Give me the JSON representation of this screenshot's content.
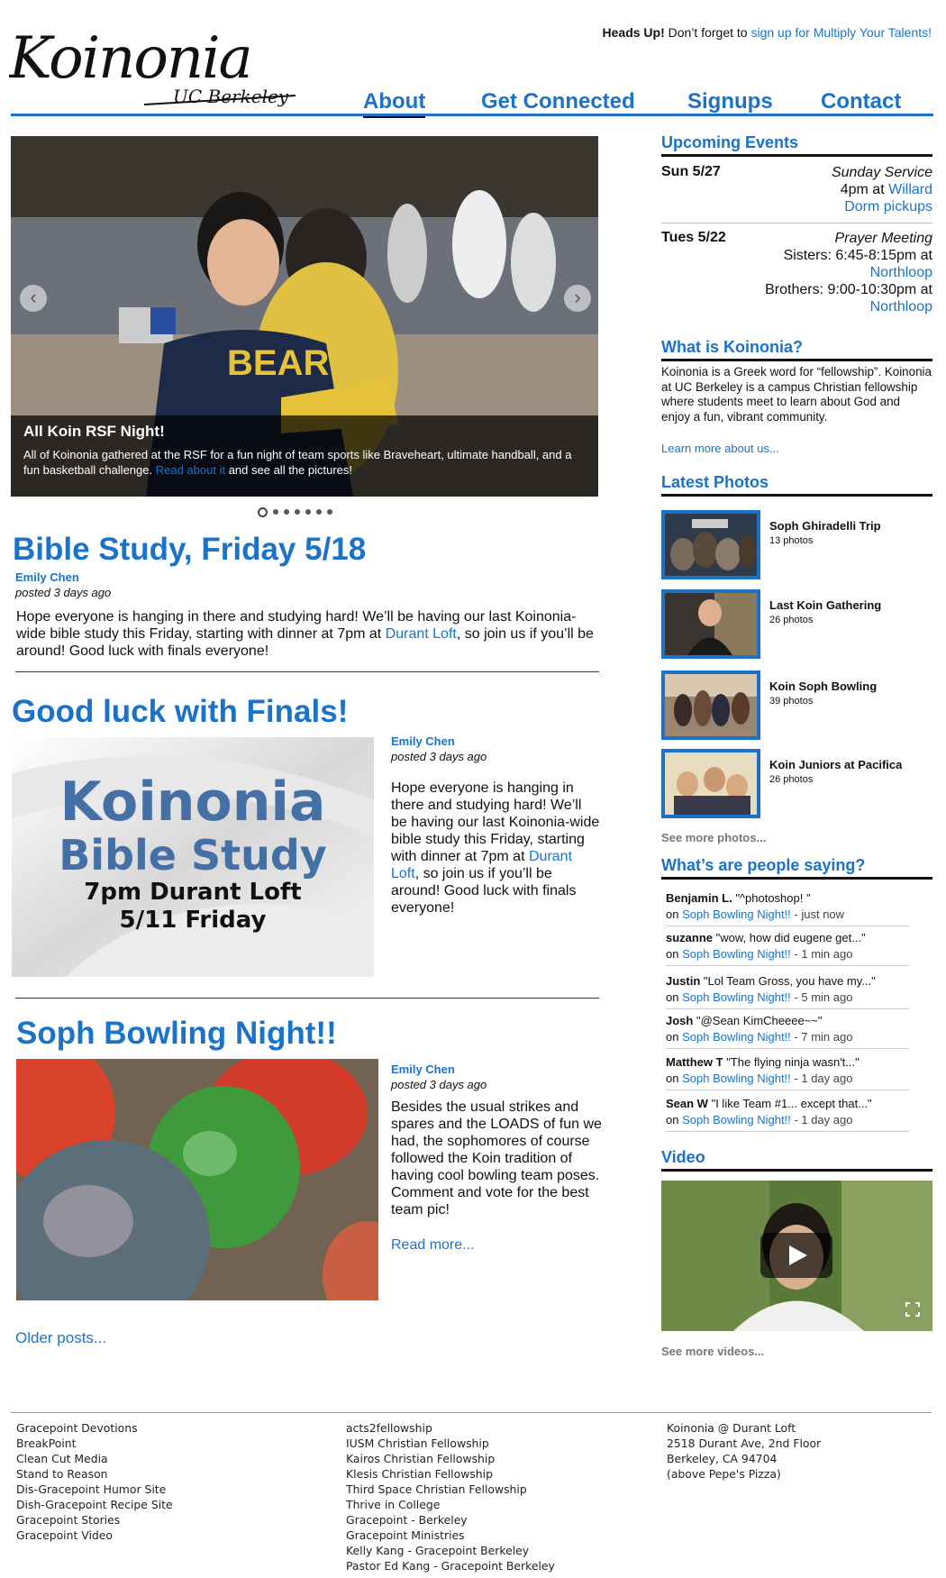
{
  "brand": {
    "name": "Koinonia",
    "sub": "UC Berkeley"
  },
  "heads_up": {
    "bold": "Heads Up!",
    "text": "Don’t forget to",
    "link": "sign up for Multiply Your Talents!"
  },
  "nav": [
    "About",
    "Get Connected",
    "Signups",
    "Contact"
  ],
  "slider": {
    "title": "All Koin RSF Night!",
    "text_before": "All of Koinonia gathered at the RSF for a fun night of team sports like Braveheart, ultimate handball, and a fun basketball challenge.",
    "link": "Read about it",
    "text_after": "and see all the pictures!",
    "shirt_text": "BEAR",
    "slides": 7,
    "active_slide": 1
  },
  "posts": [
    {
      "title": "Bible Study, Friday 5/18",
      "author": "Emily Chen",
      "posted": "posted 3 days ago",
      "body_before": "Hope everyone is hanging in there and studying hard! We’ll be having our last Koinonia-wide bible study this Friday, starting with dinner at 7pm at",
      "body_link": "Durant Loft",
      "body_after": ", so join us if you’ll be around! Good luck with finals everyone!"
    },
    {
      "title": "Good luck with Finals!",
      "author": "Emily Chen",
      "posted": "posted 3 days ago",
      "poster": {
        "line1": "Koinonia",
        "line2": "Bible Study",
        "line3": "7pm Durant Loft",
        "line4": "5/11 Friday"
      },
      "body_before": "Hope everyone is hanging in there and studying hard! We’ll be having our last Koinonia-wide bible study this Friday, starting with dinner at 7pm at",
      "body_link": "Durant Loft",
      "body_after": ", so join us if you’ll be around! Good luck with finals everyone!"
    },
    {
      "title": "Soph Bowling Night!!",
      "author": "Emily Chen",
      "posted": "posted 3 days ago",
      "body": "Besides the usual strikes and spares and the LOADS of fun we had, the sophomores of course followed the Koin tradition of having cool bowling team poses. Comment and vote for the best team pic!",
      "read_more": "Read more..."
    }
  ],
  "older_posts": "Older posts...",
  "sidebar": {
    "events_heading": "Upcoming Events",
    "events": [
      {
        "date": "Sun 5/27",
        "name": "Sunday Service",
        "time": "4pm at",
        "place": "Willard",
        "extra": "Dorm pickups"
      },
      {
        "date": "Tues 5/22",
        "name": "Prayer Meeting",
        "sisters": "Sisters: 6:45-8:15pm at",
        "sisters_place": "Northloop",
        "brothers": "Brothers: 9:00-10:30pm at",
        "brothers_place": "Northloop"
      }
    ],
    "what_heading": "What is Koinonia?",
    "what_text": "Koinonia is a Greek word for “fellowship”. Koinonia at UC Berkeley is a campus Christian fellowship where students meet to learn about God and enjoy a fun, vibrant community.",
    "learn_more": "Learn more about us...",
    "photos_heading": "Latest Photos",
    "photos": [
      {
        "title": "Soph Ghiradelli Trip",
        "count": "13 photos"
      },
      {
        "title": "Last Koin Gathering",
        "count": "26 photos"
      },
      {
        "title": "Koin Soph Bowling",
        "count": "39 photos"
      },
      {
        "title": "Koin Juniors at Pacifica",
        "count": "26 photos"
      }
    ],
    "see_more_photos": "See more photos...",
    "comments_heading": "What’s are people saying?",
    "comments": [
      {
        "user": "Benjamin L.",
        "quote": "\"^photoshop!  \"",
        "on": "on",
        "post": "Soph Bowling Night!!",
        "time": "- just now"
      },
      {
        "user": "suzanne",
        "quote": "\"wow, how did eugene get...\"",
        "on": "on",
        "post": "Soph Bowling Night!!",
        "time": "- 1 min ago"
      },
      {
        "user": "Justin",
        "quote": "\"Lol Team Gross, you have my...\"",
        "on": "on",
        "post": "Soph Bowling Night!!",
        "time": "- 5 min ago"
      },
      {
        "user": "Josh",
        "quote": "\"@Sean KimCheeee~~\"",
        "on": "on",
        "post": "Soph Bowling Night!!",
        "time": "- 7 min ago"
      },
      {
        "user": "Matthew T",
        "quote": "\"The flying ninja wasn't...\"",
        "on": "on",
        "post": "Soph Bowling Night!!",
        "time": "- 1 day ago"
      },
      {
        "user": "Sean W",
        "quote": "\"I like Team #1... except that...\"",
        "on": "on",
        "post": "Soph Bowling Night!!",
        "time": "- 1 day ago"
      }
    ],
    "video_heading": "Video",
    "see_more_videos": "See more videos..."
  },
  "footer": {
    "col1": [
      "Gracepoint Devotions",
      "BreakPoint",
      "Clean Cut Media",
      "Stand to Reason",
      "Dis-Gracepoint Humor Site",
      "Dish-Gracepoint Recipe Site",
      "Gracepoint Stories",
      "Gracepoint Video"
    ],
    "col2": [
      "acts2fellowship",
      "IUSM Christian Fellowship",
      "Kairos Christian Fellowship",
      "Klesis Christian Fellowship",
      "Third Space Christian Fellowship",
      "Thrive in College",
      "Gracepoint - Berkeley",
      "Gracepoint Ministries",
      "Kelly Kang - Gracepoint Berkeley",
      "Pastor Ed Kang - Gracepoint Berkeley"
    ],
    "col3": [
      "Koinonia @ Durant Loft",
      "2518 Durant Ave, 2nd Floor",
      "Berkeley, CA 94704",
      "(above Pepe's Pizza)"
    ]
  },
  "colors": {
    "accent": "#1a73c9",
    "text": "#111111"
  }
}
